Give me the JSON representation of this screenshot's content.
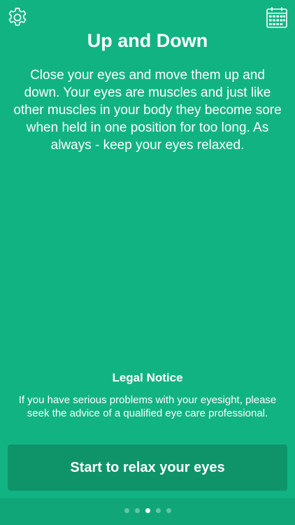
{
  "colors": {
    "background": "#12b382",
    "button": "#0f9469",
    "footer": "#10a677",
    "text": "#ffffff"
  },
  "header": {
    "settings_icon": "gear-icon",
    "calendar_icon": "calendar-icon"
  },
  "exercise": {
    "title": "Up and Down",
    "description": "Close your eyes and move them up and down. Your eyes are muscles and just like other muscles in your body they become sore when held in one position for too long. As always - keep your eyes relaxed."
  },
  "legal": {
    "title": "Legal Notice",
    "text": "If you have serious problems with your eyesight, please seek the advice of a qualified eye care professional."
  },
  "cta": {
    "label": "Start to relax your eyes"
  },
  "pager": {
    "count": 5,
    "active_index": 2
  }
}
